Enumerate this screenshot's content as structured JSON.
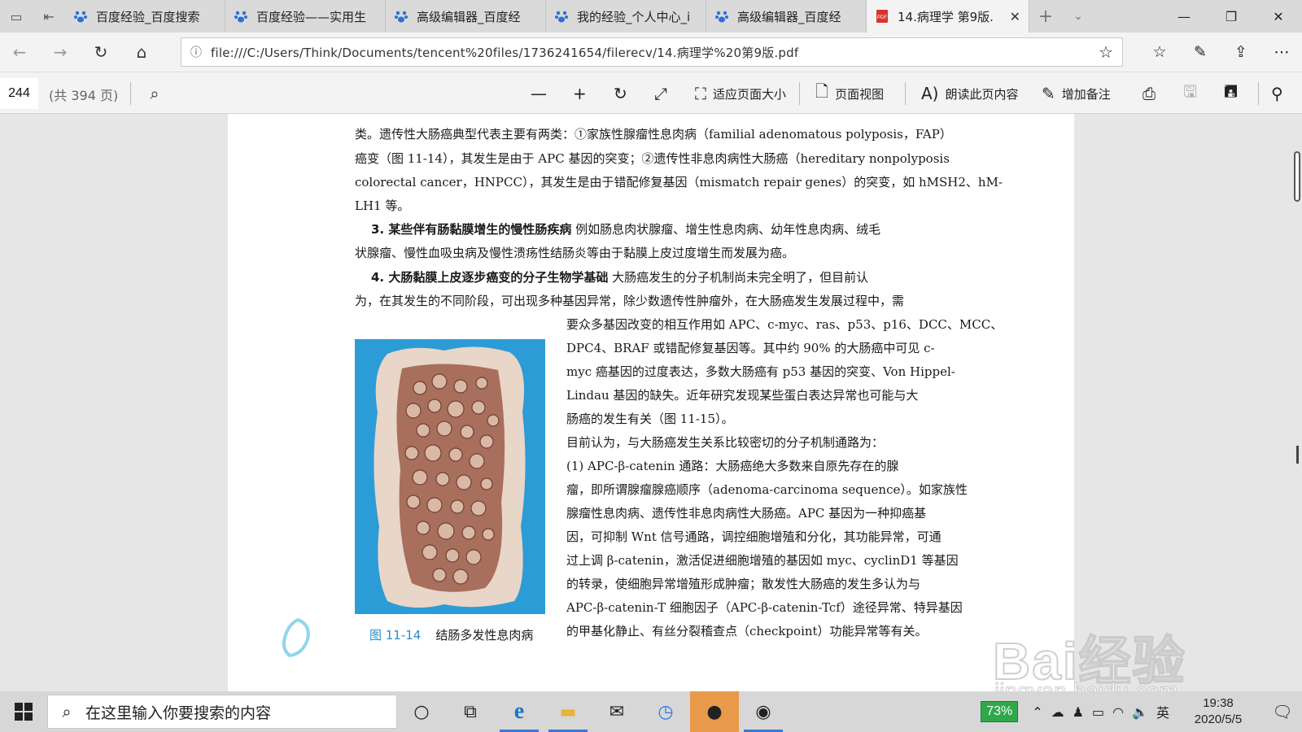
{
  "browser": {
    "tabs": [
      {
        "title": "百度经验_百度搜索",
        "icon": "baidu-paw-icon"
      },
      {
        "title": "百度经验——实用生",
        "icon": "baidu-paw-icon"
      },
      {
        "title": "高级编辑器_百度经",
        "icon": "baidu-paw-icon"
      },
      {
        "title": "我的经验_个人中心_i",
        "icon": "baidu-paw-icon"
      },
      {
        "title": "高级编辑器_百度经",
        "icon": "baidu-paw-icon"
      },
      {
        "title": "14.病理学 第9版.",
        "icon": "pdf-icon",
        "active": true
      }
    ],
    "url": "file:///C:/Users/Think/Documents/tencent%20files/1736241654/filerecv/14.病理学%20第9版.pdf"
  },
  "pdf_toolbar": {
    "page_number": "244",
    "page_total": "(共 394 页)",
    "fit_page": "适应页面大小",
    "page_view": "页面视图",
    "read_aloud": "朗读此页内容",
    "add_notes": "增加备注"
  },
  "document": {
    "lines": [
      "类。遗传性大肠癌典型代表主要有两类：①家族性腺瘤性息肉病（familial adenomatous polyposis，FAP）",
      "癌变（图 11-14），其发生是由于 APC 基因的突变；②遗传性非息肉病性大肠癌（hereditary nonpolyposis",
      "colorectal cancer，HNPCC），其发生是由于错配修复基因（mismatch repair genes）的突变，如 hMSH2、hM-",
      "LH1 等。"
    ],
    "item3_heading": "3. 某些伴有肠黏膜增生的慢性肠疾病",
    "item3_line1": "  例如肠息肉状腺瘤、增生性息肉病、幼年性息肉病、绒毛",
    "item3_line2": "状腺瘤、慢性血吸虫病及慢性溃疡性结肠炎等由于黏膜上皮过度增生而发展为癌。",
    "item4_heading": "4. 大肠黏膜上皮逐步癌变的分子生物学基础",
    "item4_line1": "  大肠癌发生的分子机制尚未完全明了，但目前认",
    "item4_line2": "为，在其发生的不同阶段，可出现多种基因异常，除少数遗传性肿瘤外，在大肠癌发生发展过程中，需",
    "right_column": [
      "要众多基因改变的相互作用如 APC、c-myc、ras、p53、p16、DCC、MCC、",
      "DPC4、BRAF 或错配修复基因等。其中约 90% 的大肠癌中可见 c-",
      "myc 癌基因的过度表达，多数大肠癌有 p53 基因的突变、Von Hippel-",
      "Lindau 基因的缺失。近年研究发现某些蛋白表达异常也可能与大",
      "肠癌的发生有关（图 11-15）。",
      "    目前认为，与大肠癌发生关系比较密切的分子机制通路为：",
      "    (1) APC-β-catenin 通路：大肠癌绝大多数来自原先存在的腺",
      "瘤，即所谓腺瘤腺癌顺序（adenoma-carcinoma sequence）。如家族性",
      "腺瘤性息肉病、遗传性非息肉病性大肠癌。APC 基因为一种抑癌基",
      "因，可抑制 Wnt 信号通路，调控细胞增殖和分化，其功能异常，可通",
      "过上调 β-catenin，激活促进细胞增殖的基因如 myc、cyclinD1 等基因",
      "的转录，使细胞异常增殖形成肿瘤；散发性大肠癌的发生多认为与",
      "APC-β-catenin-T 细胞因子（APC-β-catenin-Tcf）途径异常、特异基因",
      "的甲基化静止、有丝分裂稽查点（checkpoint）功能异常等有关。"
    ],
    "figure_number": "图 11-14",
    "figure_caption": "结肠多发性息肉病"
  },
  "watermark": {
    "brand": "Bai经验",
    "url": "jingyan.baidu.com"
  },
  "taskbar": {
    "search_placeholder": "在这里输入你要搜索的内容",
    "battery": "73%",
    "ime": "英",
    "time": "19:38",
    "date": "2020/5/5"
  },
  "colors": {
    "accent": "#2a8ed0",
    "battery_green": "#2fa84a",
    "pdf_red": "#d9342b"
  }
}
